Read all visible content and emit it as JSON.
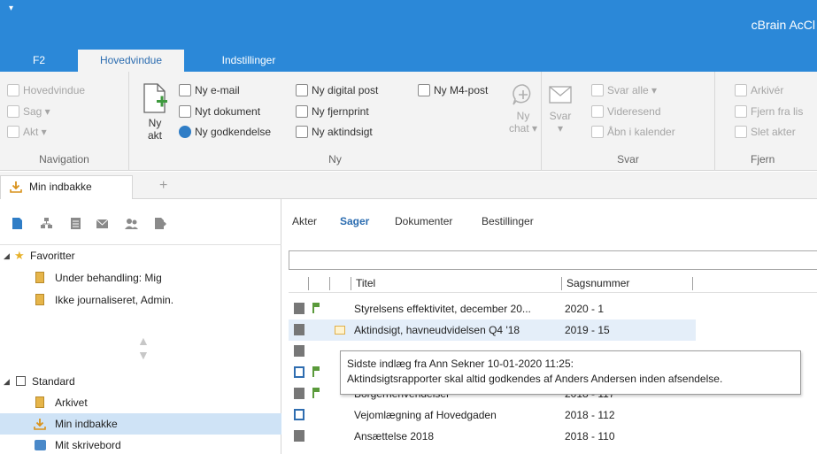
{
  "app": {
    "title": "cBrain AcCl",
    "quick_access_icon": "dropdown-arrow-icon"
  },
  "ribbon_tabs": [
    {
      "label": "F2"
    },
    {
      "label": "Hovedvindue",
      "active": true
    },
    {
      "label": "Indstillinger"
    }
  ],
  "ribbon": {
    "navigation": {
      "label": "Navigation",
      "items": [
        {
          "label": "Hovedvindue",
          "icon": "home-icon"
        },
        {
          "label": "Sag ▾",
          "icon": "case-icon"
        },
        {
          "label": "Akt ▾",
          "icon": "document-icon"
        }
      ]
    },
    "ny": {
      "label": "Ny",
      "big_button": {
        "line1": "Ny",
        "line2": "akt"
      },
      "col1": [
        {
          "label": "Ny e-mail",
          "icon": "email-icon"
        },
        {
          "label": "Nyt dokument",
          "icon": "document-icon"
        },
        {
          "label": "Ny godkendelse",
          "icon": "approval-icon"
        }
      ],
      "col2": [
        {
          "label": "Ny digital post",
          "icon": "digital-post-icon"
        },
        {
          "label": "Ny fjernprint",
          "icon": "print-icon"
        },
        {
          "label": "Ny aktindsigt",
          "icon": "insight-icon"
        }
      ],
      "m4": {
        "label": "Ny M4-post",
        "icon": "m4-post-icon"
      },
      "chat": {
        "line1": "Ny",
        "line2": "chat ▾"
      }
    },
    "svar": {
      "label": "Svar",
      "big_button": {
        "label": "Svar",
        "caret": "▾"
      },
      "items": [
        {
          "label": "Svar alle ▾",
          "icon": "reply-all-icon"
        },
        {
          "label": "Videresend",
          "icon": "forward-icon"
        },
        {
          "label": "Åbn i kalender",
          "icon": "calendar-icon"
        }
      ]
    },
    "fjern": {
      "label": "Fjern",
      "items": [
        {
          "label": "Arkivér",
          "icon": "archive-icon"
        },
        {
          "label": "Fjern fra lis",
          "icon": "remove-arrow-icon"
        },
        {
          "label": "Slet akter",
          "icon": "delete-icon"
        }
      ]
    }
  },
  "doc_tab": {
    "label": "Min indbakke",
    "add_symbol": "+"
  },
  "left_pane": {
    "favorites": {
      "label": "Favoritter",
      "items": [
        {
          "label": "Under behandling: Mig"
        },
        {
          "label": "Ikke journaliseret, Admin."
        }
      ]
    },
    "standard": {
      "label": "Standard",
      "items": [
        {
          "label": "Arkivet"
        },
        {
          "label": "Min indbakke",
          "selected": true
        },
        {
          "label": "Mit skrivebord"
        }
      ]
    }
  },
  "right_pane": {
    "tabs": [
      {
        "label": "Akter"
      },
      {
        "label": "Sager",
        "active": true
      },
      {
        "label": "Dokumenter"
      },
      {
        "label": "Bestillinger"
      }
    ],
    "search_value": "",
    "columns": {
      "title": "Titel",
      "case_number": "Sagsnummer"
    },
    "rows": [
      {
        "title": "Styrelsens effektivitet, december 20...",
        "case_number": "2020 - 1",
        "flag": true
      },
      {
        "title": "Aktindsigt, havneudvidelsen Q4 '18",
        "case_number": "2019 - 15",
        "flag": false,
        "folder": true,
        "highlight": true
      },
      {
        "title": "",
        "case_number": ""
      },
      {
        "title": "",
        "case_number": ""
      },
      {
        "title": "Borgerhenvendelser",
        "case_number": "2018 - 117",
        "flag": true
      },
      {
        "title": "Vejomlægning af Hovedgaden",
        "case_number": "2018 - 112",
        "flag": false
      },
      {
        "title": "Ansættelse 2018",
        "case_number": "2018 - 110",
        "flag": false
      }
    ],
    "tooltip": {
      "line1": "Sidste indlæg fra Ann Sekner 10-01-2020 11:25:",
      "line2": "Aktindsigtsrapporter skal altid godkendes af Anders Andersen inden afsendelse."
    }
  },
  "colors": {
    "accent": "#2b88d8",
    "ribbon_bg": "#f3f3f3",
    "selection": "#cfe3f6",
    "flag": "#5a9a3b"
  }
}
